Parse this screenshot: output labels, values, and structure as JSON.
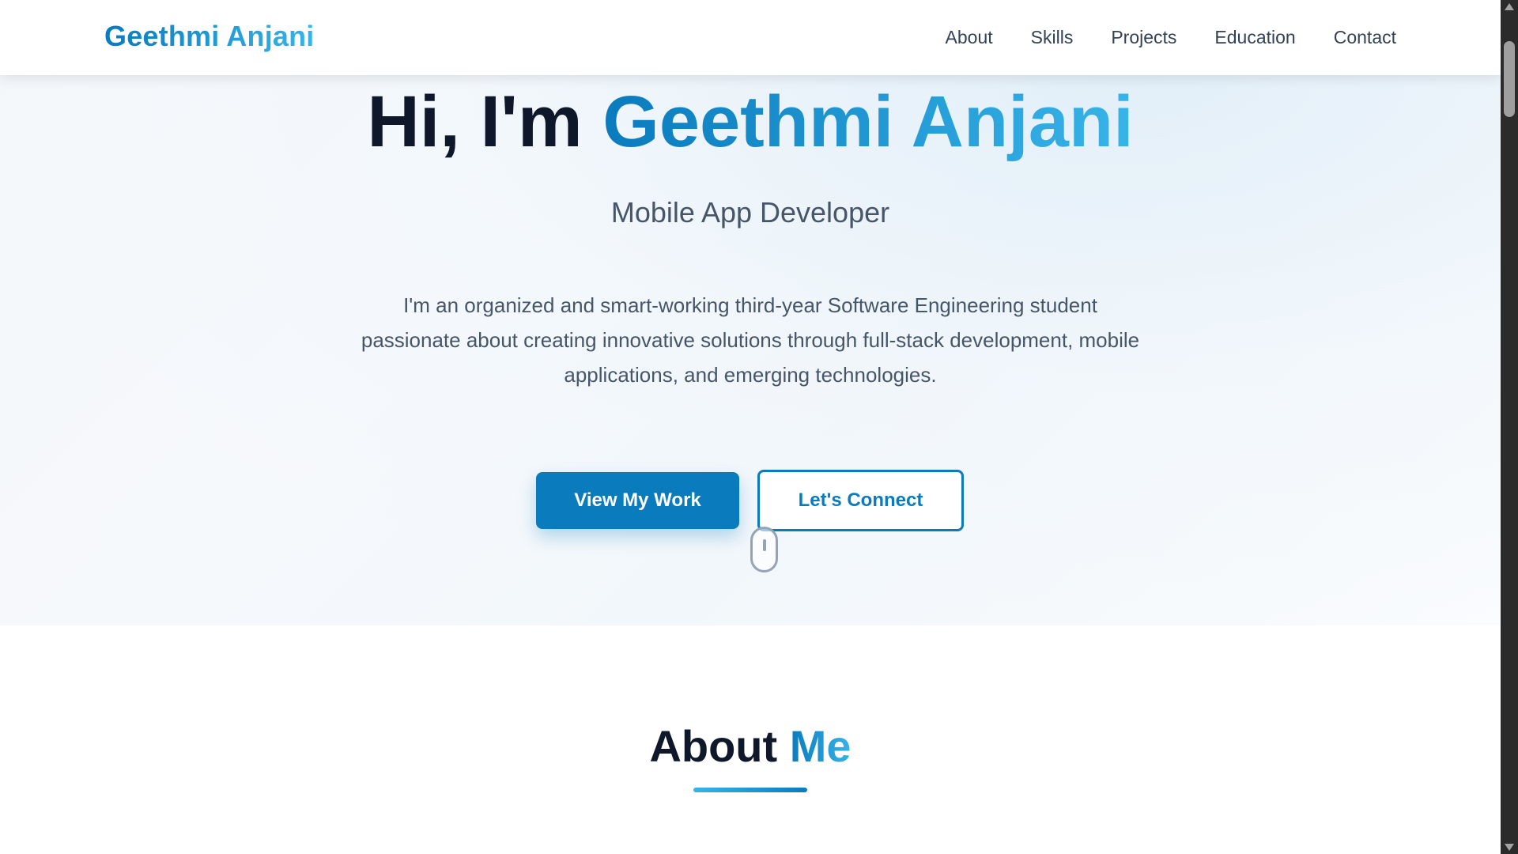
{
  "nav": {
    "logo": "Geethmi Anjani",
    "links": [
      "About",
      "Skills",
      "Projects",
      "Education",
      "Contact"
    ]
  },
  "hero": {
    "greeting": "Hi, I'm ",
    "name": "Geethmi Anjani",
    "subtitle": "Mobile App Developer",
    "description": "I'm an organized and smart-working third-year Software Engineering student passionate about creating innovative solutions through full-stack development, mobile applications, and emerging technologies.",
    "primary_button": "View My Work",
    "secondary_button": "Let's Connect",
    "scroll_indicator_icon": "mouse-scroll-icon"
  },
  "about": {
    "title_main": "About ",
    "title_accent": "Me"
  },
  "colors": {
    "accent": "#0a7bbd",
    "accent_light": "#38b4e8",
    "heading": "#0f172a",
    "body_text": "#475569"
  }
}
